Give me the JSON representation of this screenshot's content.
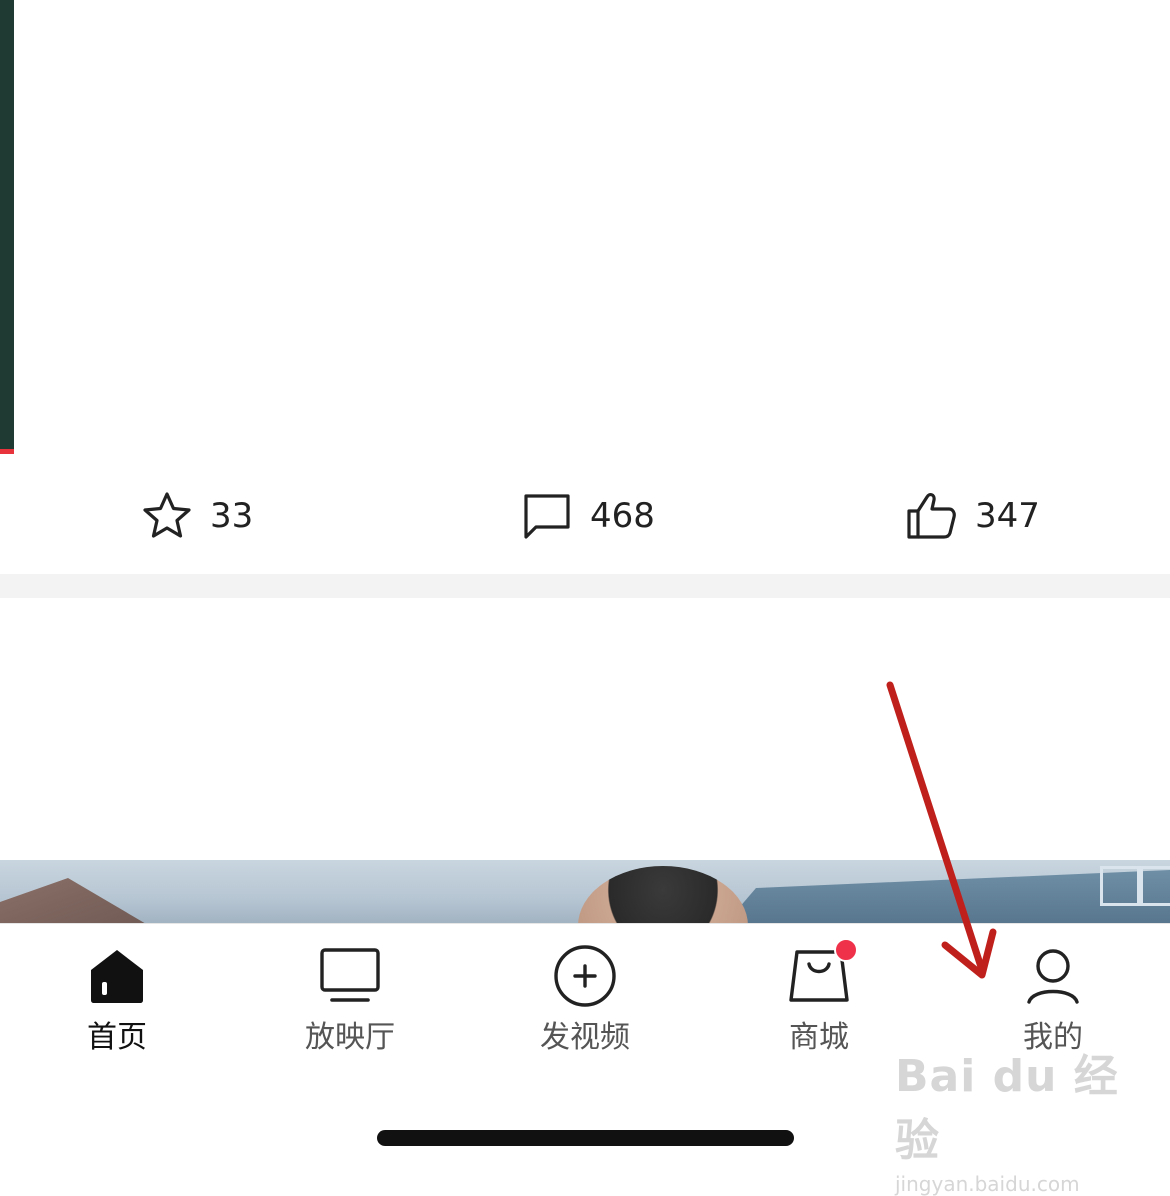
{
  "post_actions": {
    "favorite_count": "33",
    "comment_count": "468",
    "like_count": "347"
  },
  "tab_bar": {
    "items": [
      {
        "label": "首页",
        "icon": "home-icon",
        "active": true
      },
      {
        "label": "放映厅",
        "icon": "tv-icon",
        "active": false
      },
      {
        "label": "发视频",
        "icon": "add-circle-icon",
        "active": false
      },
      {
        "label": "商城",
        "icon": "shopping-bag-icon",
        "active": false,
        "badge": true
      },
      {
        "label": "我的",
        "icon": "user-icon",
        "active": false
      }
    ]
  },
  "annotation": {
    "arrow_color": "#c0201c"
  },
  "watermark": {
    "brand": "Bai du 经验",
    "url": "jingyan.baidu.com"
  },
  "colors": {
    "accent_red": "#f0314a",
    "text_dark": "#111111"
  }
}
